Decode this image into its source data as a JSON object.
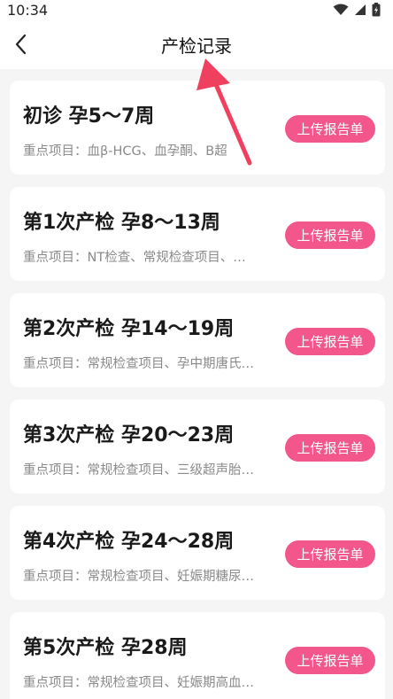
{
  "status_bar": {
    "time": "10:34"
  },
  "header": {
    "title": "产检记录",
    "back_icon": "chevron-left-icon"
  },
  "colors": {
    "accent": "#f2568a",
    "annotation_arrow": "#f0405f"
  },
  "records": [
    {
      "title": "初诊 孕5～7周",
      "desc": "重点项目：血β-HCG、血孕酮、B超",
      "button": "上传报告单"
    },
    {
      "title": "第1次产检 孕8～13周",
      "desc": "重点项目：NT检查、常规检查项目、…",
      "button": "上传报告单"
    },
    {
      "title": "第2次产检 孕14～19周",
      "desc": "重点项目：常规检查项目、孕中期唐氏…",
      "button": "上传报告单"
    },
    {
      "title": "第3次产检 孕20～23周",
      "desc": "重点项目：常规检查项目、三级超声胎…",
      "button": "上传报告单"
    },
    {
      "title": "第4次产检 孕24～28周",
      "desc": "重点项目：常规检查项目、妊娠期糖尿…",
      "button": "上传报告单"
    },
    {
      "title": "第5次产检 孕28周",
      "desc": "重点项目：常规检查项目、妊娠期高血…",
      "button": "上传报告单"
    }
  ]
}
